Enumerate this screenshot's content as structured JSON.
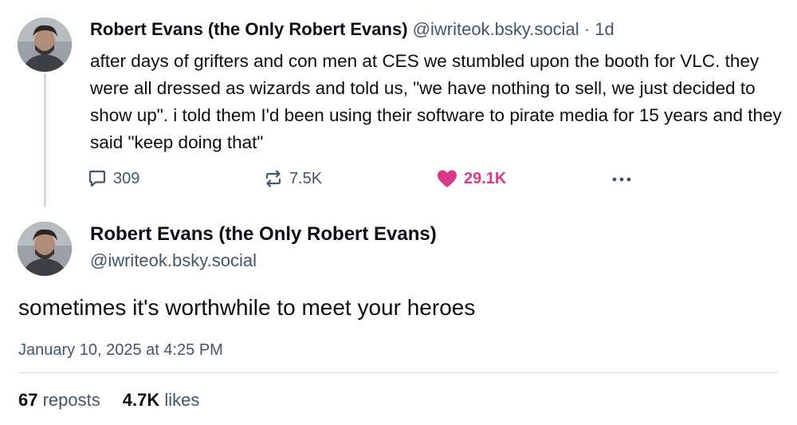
{
  "reply_parent": {
    "author_name": "Robert Evans (the Only Robert Evans)",
    "handle": "@iwriteok.bsky.social",
    "separator": " · ",
    "age": "1d",
    "text": "after days of grifters and con men at CES we stumbled upon the booth for VLC. they were all dressed as wizards and told us, \"we have nothing to sell, we just decided to show up\". i told them I'd been using their software to pirate media for 15 years and they said \"keep doing that\"",
    "replies": "309",
    "reposts": "7.5K",
    "likes": "29.1K",
    "icons": {
      "reply": "speech-bubble-icon",
      "repost": "repost-arrows-icon",
      "like": "heart-filled-icon",
      "more": "ellipsis-icon"
    },
    "like_color": "#d93a8a"
  },
  "main_post": {
    "author_name": "Robert Evans (the Only Robert Evans)",
    "handle": "@iwriteok.bsky.social",
    "text": "sometimes it's worthwhile to meet your heroes",
    "timestamp": "January 10, 2025 at 4:25 PM",
    "reposts_count": "67",
    "reposts_label": "reposts",
    "likes_count": "4.7K",
    "likes_label": "likes"
  }
}
